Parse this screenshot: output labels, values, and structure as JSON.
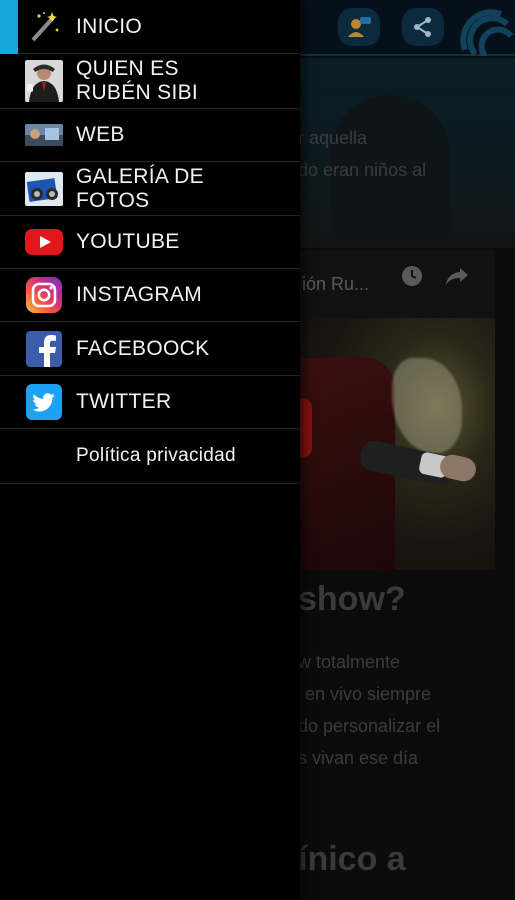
{
  "menu": {
    "items": [
      {
        "label": "INICIO",
        "icon": "magic-wand-icon",
        "active": true
      },
      {
        "label": "QUIEN ES\nRUBÉN SIBI",
        "icon": "profile-photo"
      },
      {
        "label": "WEB",
        "icon": "web-photo"
      },
      {
        "label": "GALERÍA DE\nFOTOS",
        "icon": "gallery-photo"
      },
      {
        "label": "YOUTUBE",
        "icon": "youtube-icon"
      },
      {
        "label": "INSTAGRAM",
        "icon": "instagram-icon"
      },
      {
        "label": "FACEBOOCK",
        "icon": "facebook-icon"
      },
      {
        "label": "TWITTER",
        "icon": "twitter-icon"
      },
      {
        "label": "Política privacidad",
        "icon": ""
      }
    ],
    "accent_color": "#19a7d9"
  },
  "background": {
    "intro_line1": "r aquella",
    "intro_line2": "do eran niños al",
    "video_title": "ión Ru...",
    "heading1": "show?",
    "para_line1": "w totalmente",
    "para_line2": "en vivo siempre",
    "para_line3": "do personalizar el",
    "para_line4": "s vivan ese día",
    "heading2": "ínico a"
  }
}
